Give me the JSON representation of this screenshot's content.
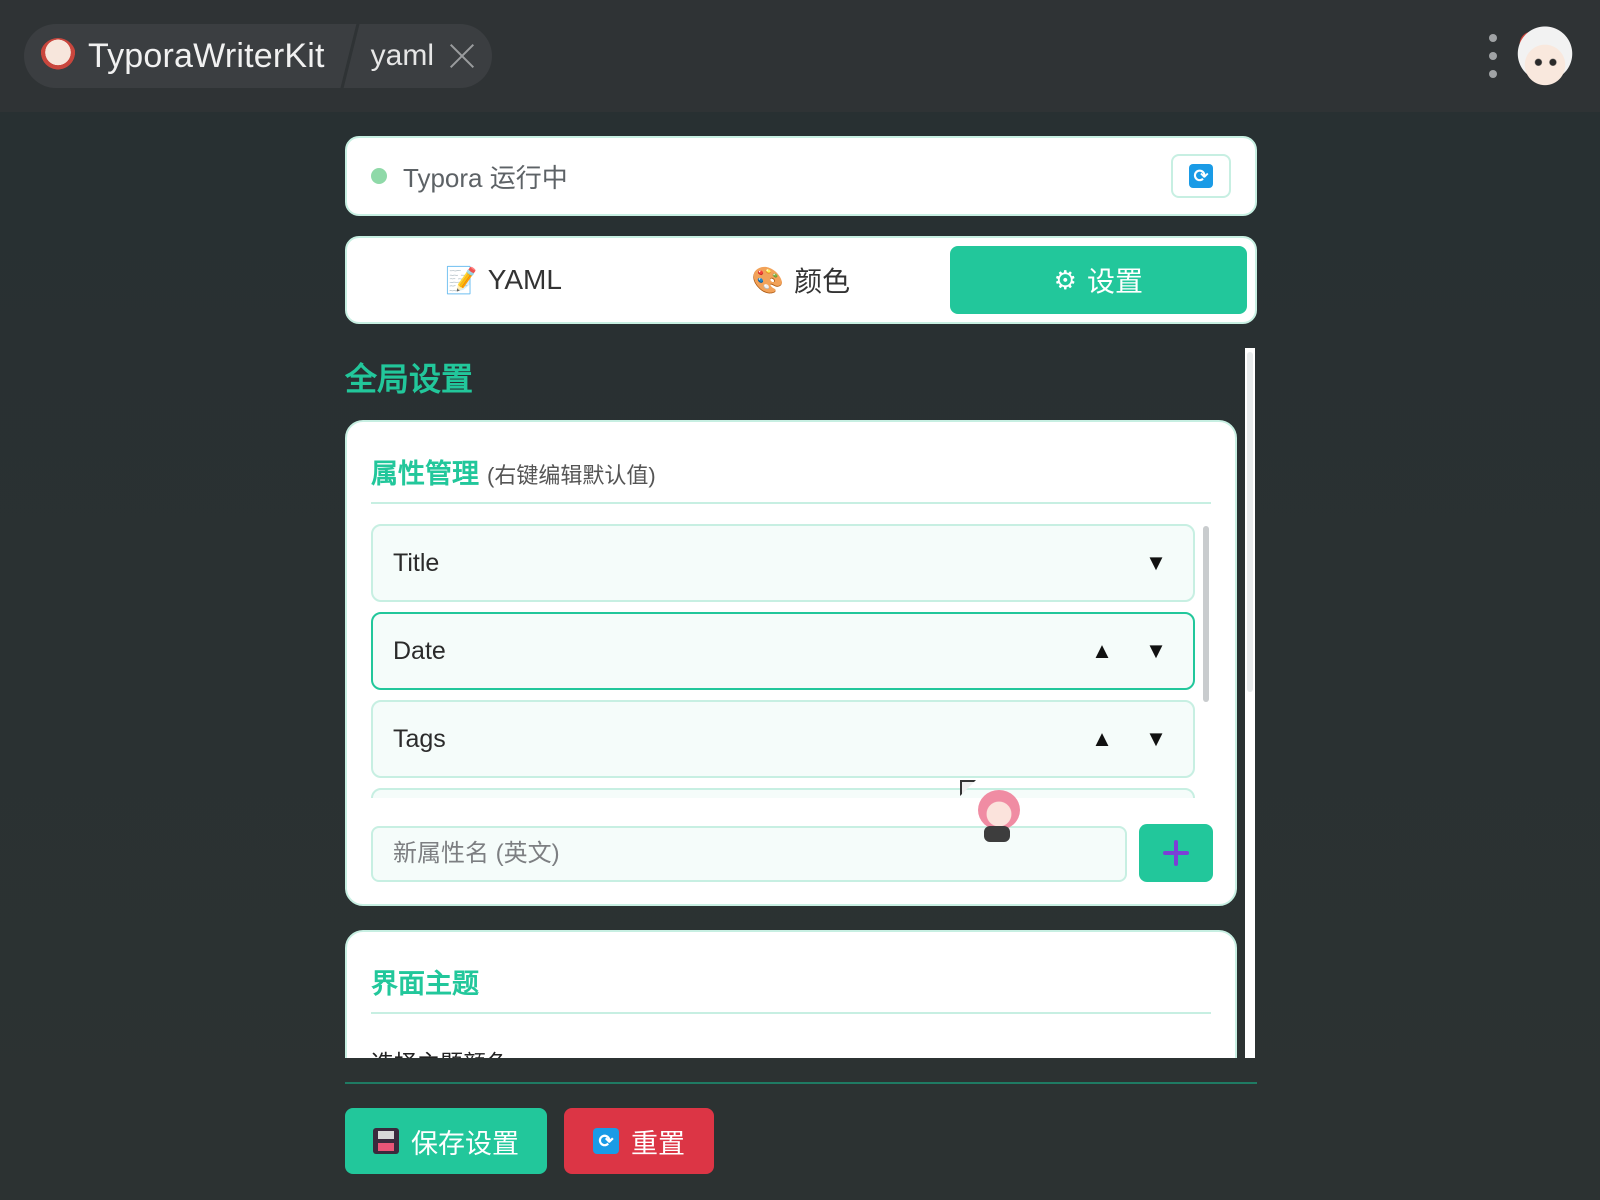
{
  "window": {
    "app_name": "TyporaWriterKit",
    "document_tab": "yaml"
  },
  "status": {
    "text": "Typora 运行中",
    "dot_color": "#8fd9a8",
    "refresh_icon": "refresh-icon",
    "refresh_glyph": "⟳"
  },
  "tabs": [
    {
      "label": "YAML",
      "icon": "memo-icon",
      "glyph": "📝",
      "active": false
    },
    {
      "label": "颜色",
      "icon": "palette-icon",
      "glyph": "🎨",
      "active": false
    },
    {
      "label": "设置",
      "icon": "gear-icon",
      "glyph": "⚙",
      "active": true
    }
  ],
  "settings": {
    "section_title": "全局设置",
    "attributes": {
      "title": "属性管理",
      "subtitle": "(右键编辑默认值)",
      "items": [
        {
          "name": "Title",
          "controls": [
            "▼"
          ]
        },
        {
          "name": "Date",
          "controls": [
            "▲",
            "▼"
          ],
          "selected": true
        },
        {
          "name": "Tags",
          "controls": [
            "▲",
            "▼"
          ]
        }
      ],
      "new_attr_placeholder": "新属性名 (英文)",
      "add_icon": "plus-icon"
    },
    "theme": {
      "title": "界面主题",
      "label": "选择主题颜色:"
    }
  },
  "footer": {
    "save_label": "保存设置",
    "reset_label": "重置"
  },
  "colors": {
    "accent": "#22c79b",
    "danger": "#dc3545",
    "border": "#c7efe2"
  }
}
